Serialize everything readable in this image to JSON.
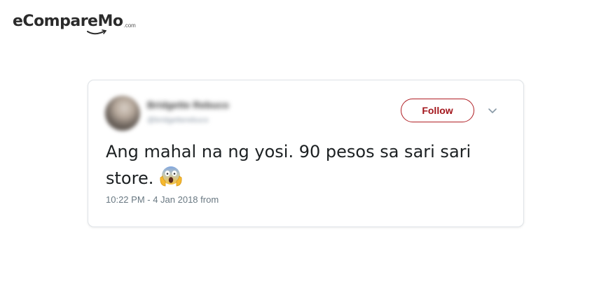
{
  "logo": {
    "main": "eCompareMo",
    "sub": ".com"
  },
  "tweet": {
    "author_name": "Bridgette Rebuco",
    "author_handle": "@bridgetterebuco",
    "follow_label": "Follow",
    "text_line1": "Ang mahal na ng yosi. 90 pesos sa sari sari",
    "text_line2": "store.",
    "emoji": "face-screaming-in-fear-emoji",
    "meta": "10:22 PM - 4 Jan 2018 from",
    "menu_icon": "chevron-down-icon"
  },
  "colors": {
    "follow_border": "#b01e24",
    "follow_text": "#a3161c",
    "meta_text": "#697882",
    "tweet_text": "#1c2022",
    "card_border": "#dfe3e7"
  }
}
